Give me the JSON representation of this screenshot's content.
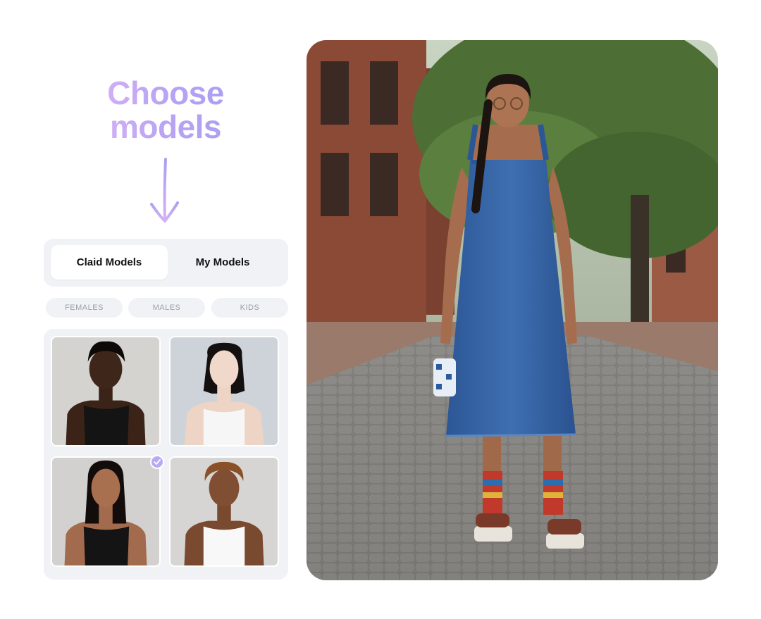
{
  "heading": {
    "line1": "Choose",
    "line2": "models"
  },
  "tabs": [
    {
      "label": "Claid Models",
      "active": true
    },
    {
      "label": "My Models",
      "active": false
    }
  ],
  "filters": [
    "FEMALES",
    "MALES",
    "KIDS"
  ],
  "models": [
    {
      "icon": "model-portrait",
      "tank": "black",
      "selected": false
    },
    {
      "icon": "model-portrait",
      "tank": "white",
      "selected": false
    },
    {
      "icon": "model-portrait",
      "tank": "black",
      "selected": true
    },
    {
      "icon": "model-portrait",
      "tank": "white",
      "selected": false
    }
  ],
  "colors": {
    "accent": "#b9a8f3",
    "panel": "#f1f2f6",
    "heading_gradient": [
      "#d8b4f5",
      "#a79ef2"
    ]
  }
}
